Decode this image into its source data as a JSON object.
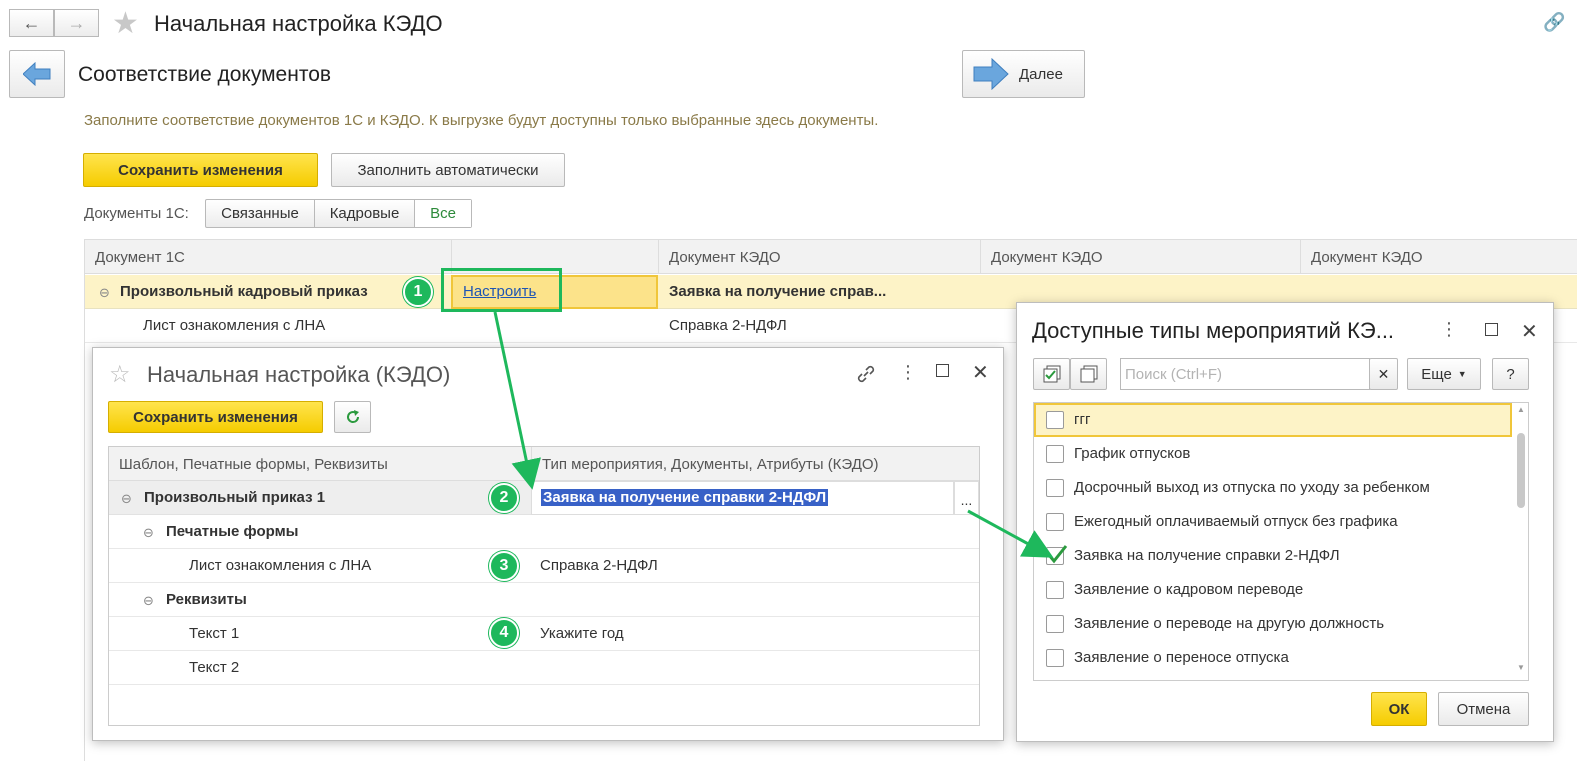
{
  "window": {
    "title": "Начальная настройка КЭДО"
  },
  "header": {
    "title": "Соответствие документов",
    "next_label": "Далее"
  },
  "info_text": "Заполните соответствие документов 1С и КЭДО. К выгрузке будут доступны только выбранные здесь документы.",
  "toolbar": {
    "save_label": "Сохранить изменения",
    "autofill_label": "Заполнить автоматически"
  },
  "filter": {
    "label": "Документы 1С:",
    "options": [
      "Связанные",
      "Кадровые",
      "Все"
    ],
    "selected": "Все"
  },
  "main_table": {
    "columns": [
      "Документ 1С",
      "",
      "Документ КЭДО",
      "Документ КЭДО",
      "Документ КЭДО"
    ],
    "rows": [
      {
        "doc1c": "Произвольный кадровый приказ",
        "link": "Настроить",
        "kedo": "Заявка на получение справ..."
      },
      {
        "doc1c": "Лист ознакомления с ЛНА",
        "kedo": "Справка 2-НДФЛ"
      }
    ]
  },
  "settings_dialog": {
    "title": "Начальная настройка (КЭДО)",
    "save_label": "Сохранить изменения",
    "columns": [
      "Шаблон, Печатные формы, Реквизиты",
      "Тип мероприятия, Документы, Атрибуты (КЭДО)"
    ],
    "rows": [
      {
        "name": "Произвольный приказ 1",
        "value": "Заявка на получение справки 2-НДФЛ"
      },
      {
        "name": "Печатные формы",
        "value": ""
      },
      {
        "name": "Лист ознакомления с ЛНА",
        "value": "Справка 2-НДФЛ"
      },
      {
        "name": "Реквизиты",
        "value": ""
      },
      {
        "name": "Текст 1",
        "value": "Укажите год"
      },
      {
        "name": "Текст 2",
        "value": ""
      }
    ],
    "more_label": "..."
  },
  "types_dialog": {
    "title": "Доступные типы мероприятий КЭ...",
    "search_placeholder": "Поиск (Ctrl+F)",
    "more_label": "Еще",
    "help_label": "?",
    "items": [
      {
        "label": "ггг",
        "checked": false
      },
      {
        "label": "График отпусков",
        "checked": false
      },
      {
        "label": "Досрочный выход из отпуска по уходу за ребенком",
        "checked": false
      },
      {
        "label": "Ежегодный оплачиваемый отпуск без графика",
        "checked": false
      },
      {
        "label": "Заявка на получение справки 2-НДФЛ",
        "checked": true
      },
      {
        "label": "Заявление о кадровом переводе",
        "checked": false
      },
      {
        "label": "Заявление о переводе на другую должность",
        "checked": false
      },
      {
        "label": "Заявление о переносе отпуска",
        "checked": false
      }
    ],
    "ok_label": "ОК",
    "cancel_label": "Отмена"
  },
  "badges": [
    "1",
    "2",
    "3",
    "4"
  ],
  "colors": {
    "accent_green": "#1eb85c",
    "selected_row": "#fdf3c7",
    "link": "#1f55b3",
    "info_text": "#8a7a48"
  }
}
